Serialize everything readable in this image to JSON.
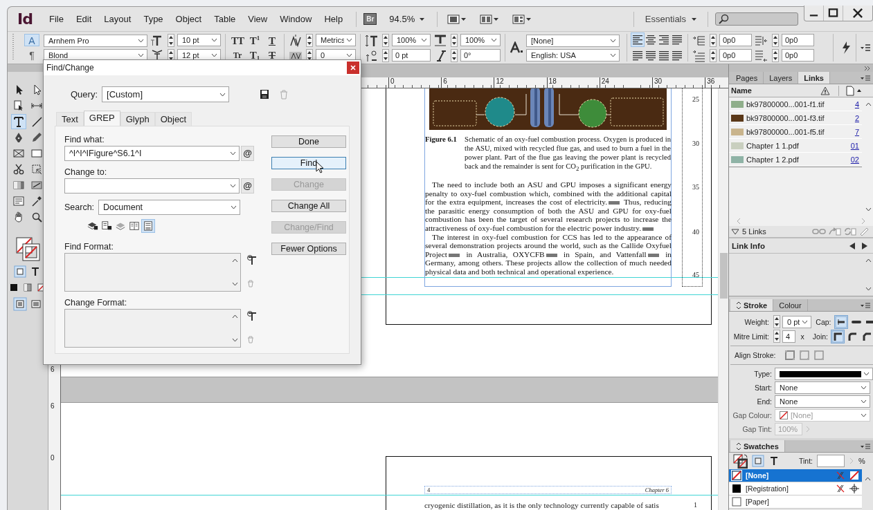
{
  "app": {
    "logo": "Id",
    "menus": [
      "File",
      "Edit",
      "Layout",
      "Type",
      "Object",
      "Table",
      "View",
      "Window",
      "Help"
    ],
    "bridge": "Br",
    "zoom": "94.5%",
    "workspace": "Essentials"
  },
  "control_panel": {
    "modes": [
      {
        "label": "A",
        "selected": true
      },
      {
        "label": "¶",
        "selected": false
      }
    ],
    "font_family": "Arnhem Pro",
    "font_style": "Blond",
    "font_size": "10 pt",
    "leading": "12 pt",
    "case_buttons": [
      {
        "label": "TT",
        "kind": "caps"
      },
      {
        "label": "T$^{1}$",
        "kind": "plain"
      },
      {
        "label": "T",
        "kind": "underline"
      },
      {
        "label": "Tr",
        "kind": "small"
      },
      {
        "label": "T$_{1}$",
        "kind": "plain"
      },
      {
        "label": "T",
        "kind": "strike"
      }
    ],
    "kerning": "Metrics",
    "tracking": "0",
    "vertical_scale": "100%",
    "baseline_shift": "0 pt",
    "horizontal_scale": "100%",
    "skew": "0°",
    "character_style": "[None]",
    "language": "English: USA",
    "alignment": [
      {
        "kind": "left",
        "selected": true
      },
      {
        "kind": "center",
        "selected": false
      },
      {
        "kind": "right",
        "selected": false
      },
      {
        "kind": "spine",
        "selected": false
      },
      {
        "kind": "justify",
        "selected": false
      },
      {
        "kind": "justify",
        "selected": false
      },
      {
        "kind": "justify",
        "selected": false
      },
      {
        "kind": "spine",
        "selected": false
      }
    ],
    "indents": [
      "0p0",
      "0p0",
      "0p0",
      "0p0"
    ]
  },
  "tools": [
    {
      "kind": "select",
      "selected": false
    },
    {
      "kind": "direct",
      "selected": false
    },
    {
      "kind": "page",
      "selected": false
    },
    {
      "kind": "gap",
      "selected": false
    },
    {
      "kind": "type",
      "selected": true
    },
    {
      "kind": "line",
      "selected": false
    },
    {
      "kind": "pen",
      "selected": false
    },
    {
      "kind": "pencil",
      "selected": false
    },
    {
      "kind": "frame",
      "selected": false
    },
    {
      "kind": "rect",
      "selected": false
    },
    {
      "kind": "scissors",
      "selected": false
    },
    {
      "kind": "transform",
      "selected": false
    },
    {
      "kind": "gradient",
      "selected": false
    },
    {
      "kind": "feather",
      "selected": false
    },
    {
      "kind": "note",
      "selected": false
    },
    {
      "kind": "eyedropper",
      "selected": false
    },
    {
      "kind": "hand",
      "selected": false
    },
    {
      "kind": "zoom",
      "selected": false
    }
  ],
  "dialog": {
    "title": "Find/Change",
    "query_label": "Query:",
    "query": "[Custom]",
    "tabs": [
      {
        "label": "Text",
        "selected": false
      },
      {
        "label": "GREP",
        "selected": true
      },
      {
        "label": "Glyph",
        "selected": false
      },
      {
        "label": "Object",
        "selected": false
      }
    ],
    "find_label": "Find what:",
    "find_value": "^I^I^IFigure^S6.1^I",
    "find_special": "@",
    "change_label": "Change to:",
    "change_special": "@",
    "search_label": "Search:",
    "search": "Document",
    "options": [
      {
        "kind": "locked-layers",
        "on": false
      },
      {
        "kind": "locked-stories",
        "on": false
      },
      {
        "kind": "hidden-layers",
        "on": false
      },
      {
        "kind": "master-pages",
        "on": false
      },
      {
        "kind": "footnotes",
        "on": true
      }
    ],
    "find_format_label": "Find Format:",
    "change_format_label": "Change Format:",
    "buttons": [
      {
        "label": "Done",
        "disabled": false,
        "focused": false
      },
      {
        "label": "Find",
        "disabled": false,
        "focused": true
      },
      {
        "label": "Change",
        "disabled": true,
        "focused": false
      },
      {
        "label": "Change All",
        "disabled": false,
        "focused": false
      },
      {
        "label": "Change/Find",
        "disabled": true,
        "focused": false
      },
      {
        "label": "Fewer Options",
        "disabled": false,
        "focused": false
      }
    ]
  },
  "document": {
    "ruler_labels": [
      "0",
      "6",
      "12",
      "18",
      "24",
      "30",
      "36"
    ],
    "vertical_ruler_labels": [
      "6",
      "6",
      "0"
    ],
    "figure_label": "Figure 6.1",
    "caption": "Schematic of an oxy-fuel combustion process. Oxygen is produced in the ASU, mixed with recycled flue gas, and used to burn a fuel in the power plant. Part of the flue gas leaving the power plant is recycled back and the remainder is sent for CO$_{2}$ purification in the GPU.",
    "paragraphs": [
      {
        "segments": [
          "The need to include both an ASU and GPU imposes a significant energy penalty to oxy-fuel combustion which, combined with the additional capital for the extra equipment, increases the cost of electricity.",
          " Thus, reducing the parasitic energy consumption of both the ASU and GPU for oxy-fuel combustion has been the target of several research projects to increase the attractiveness of oxy-fuel combustion for the electric power industry."
        ],
        "end_marker": true
      },
      {
        "segments": [
          "The interest in oxy-fuel combustion for CCS has led to the appearance of several demonstration projects around the world, such as the Callide Oxyfuel Project",
          " in Australia, OXYCFB",
          " in Spain, and Vattenfall",
          " in Germany, among others. These projects allow the collection of much needed physical data and both technical and operational experience."
        ],
        "end_marker": false
      }
    ],
    "line_numbers": [
      "25",
      "30",
      "35",
      "40",
      "45"
    ],
    "next_page": {
      "folio": "4",
      "running_head": "Chapter 6",
      "first_line": "cryogenic distillation, as it is the only technology currently capable of satis",
      "line_number": "1"
    }
  },
  "links_panel": {
    "tabs": [
      {
        "label": "Pages",
        "selected": false
      },
      {
        "label": "Layers",
        "selected": false
      },
      {
        "label": "Links",
        "selected": true
      }
    ],
    "column": "Name",
    "links": [
      {
        "name": "bk97800000...001-f1.tif",
        "page": "4",
        "color": "#8fae8a"
      },
      {
        "name": "bk97800000...001-f3.tif",
        "page": "2",
        "color": "#5a3818"
      },
      {
        "name": "bk97800000...001-f5.tif",
        "page": "7",
        "color": "#c9b48c"
      },
      {
        "name": "Chapter 1 1.pdf",
        "page": "01",
        "color": "#c9cfbf"
      },
      {
        "name": "Chapter 1 2.pdf",
        "page": "02",
        "color": "#8fb3a6"
      }
    ],
    "count": "5 Links",
    "link_info": "Link Info"
  },
  "stroke_panel": {
    "tabs": [
      {
        "label": "Stroke",
        "selected": true
      },
      {
        "label": "Colour",
        "selected": false
      }
    ],
    "weight_label": "Weight:",
    "weight": "0 pt",
    "cap_label": "Cap:",
    "mitre_label": "Mitre Limit:",
    "mitre": "4",
    "mitre_unit": "x",
    "join_label": "Join:",
    "align_label": "Align Stroke:",
    "type_label": "Type:",
    "start_label": "Start:",
    "start": "None",
    "end_label": "End:",
    "end": "None",
    "gap_colour_label": "Gap Colour:",
    "gap_colour": "[None]",
    "gap_tint_label": "Gap Tint:",
    "gap_tint": "100%",
    "gap_disabled": true
  },
  "swatches_panel": {
    "title": "Swatches",
    "tint_label": "Tint:",
    "tint_unit": "%",
    "swatches": [
      {
        "name": "[None]",
        "kind": "none",
        "selected": true
      },
      {
        "name": "[Registration]",
        "kind": "registration",
        "selected": false
      },
      {
        "name": "[Paper]",
        "kind": "paper",
        "selected": false
      }
    ]
  }
}
